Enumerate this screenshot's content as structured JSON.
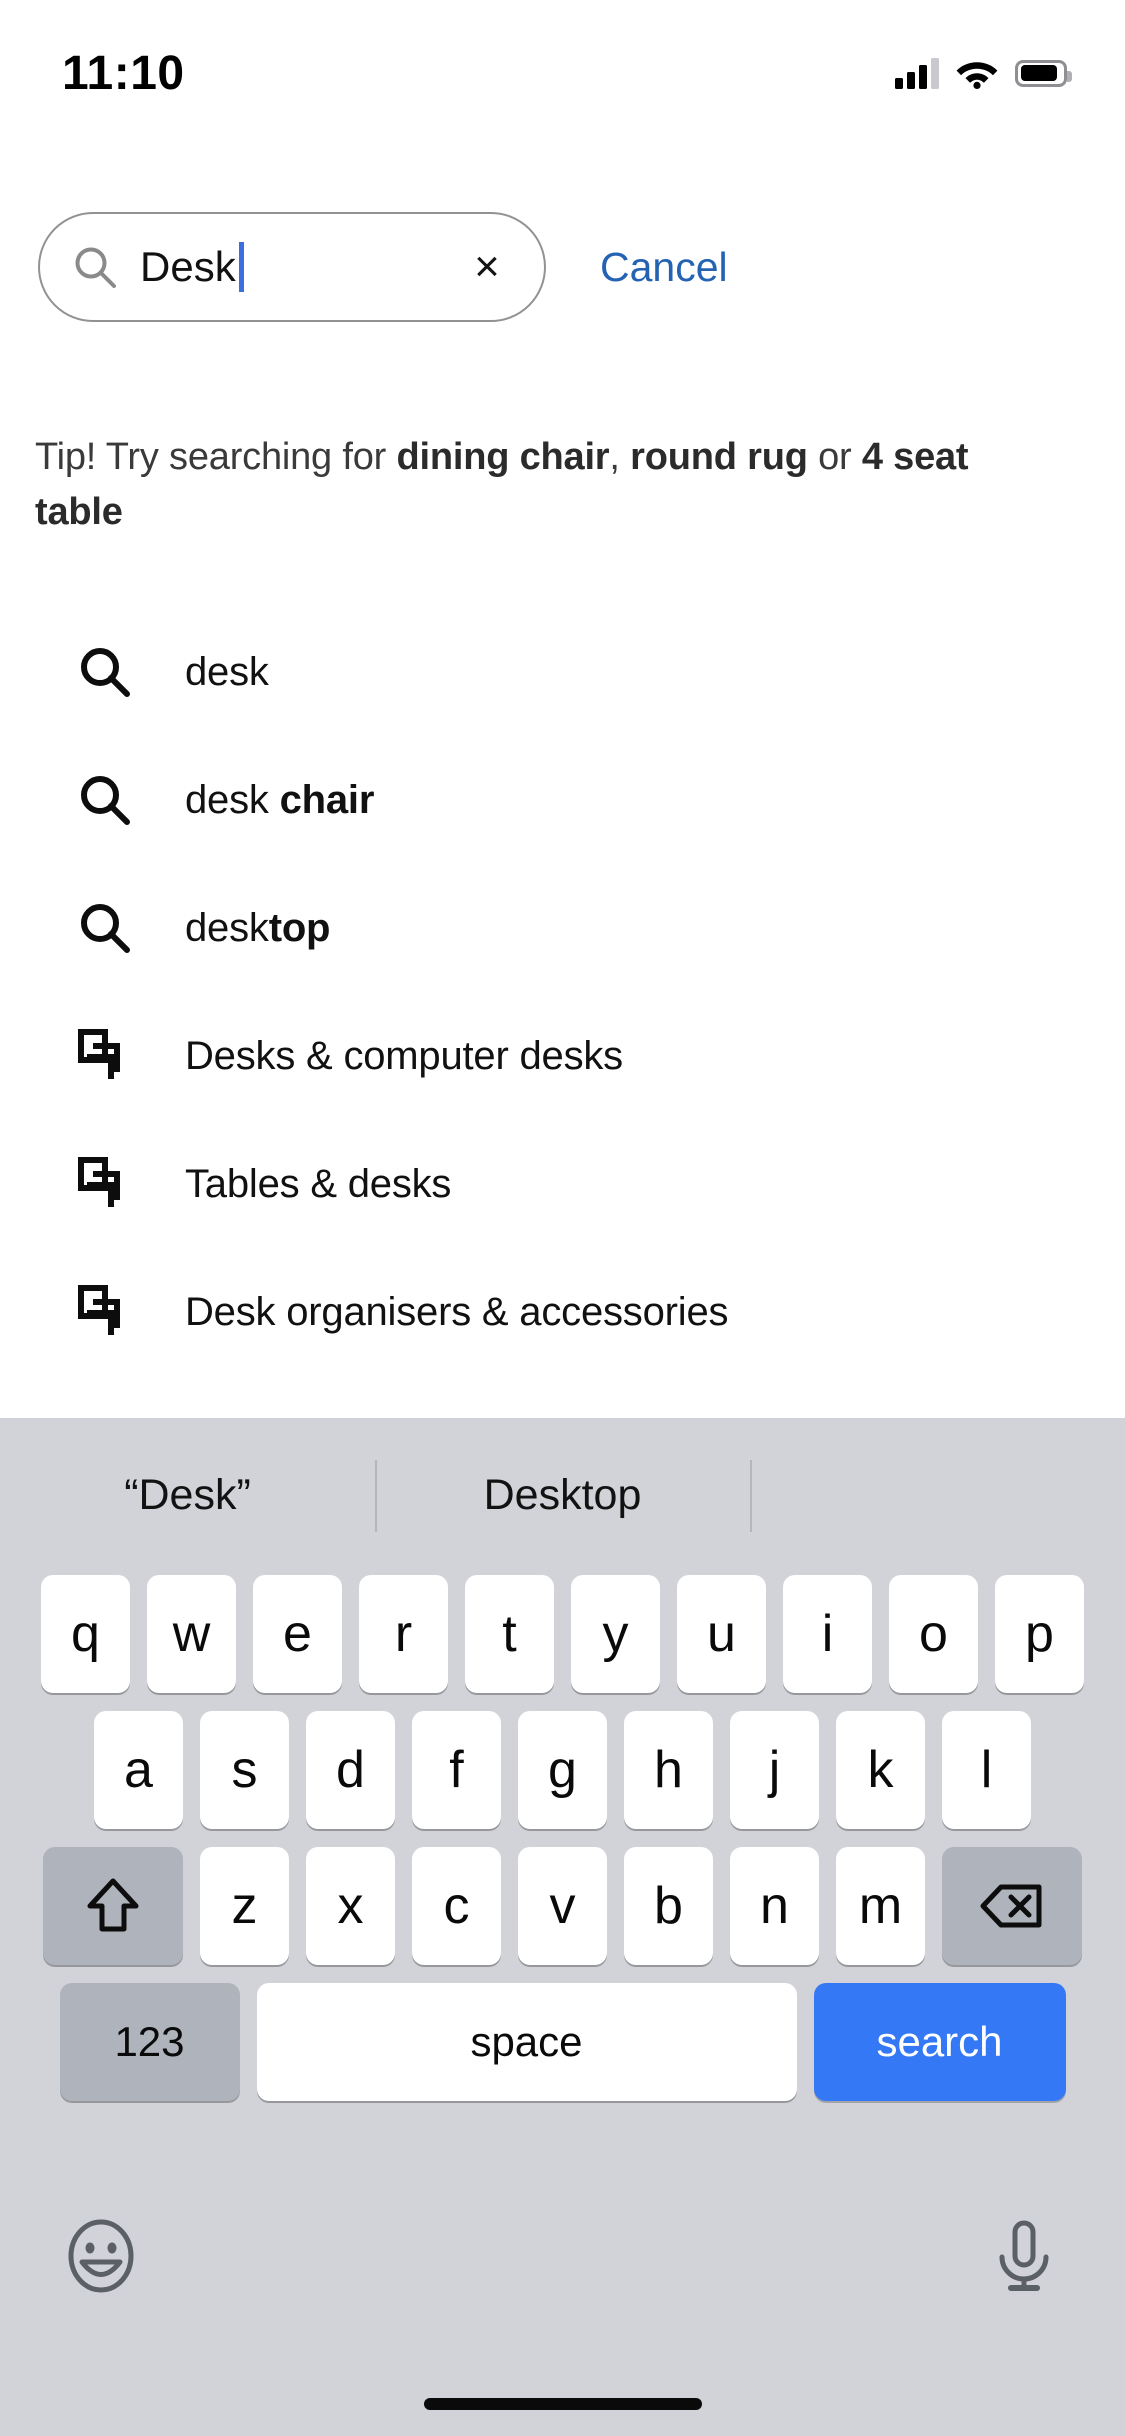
{
  "status_bar": {
    "time": "11:10",
    "signal_icon": "cellular-signal-icon",
    "wifi_icon": "wifi-icon",
    "battery_icon": "battery-icon",
    "battery_level_percent": 88
  },
  "search": {
    "icon": "search-icon",
    "value": "Desk",
    "clear_label": "×",
    "clear_icon": "close-icon",
    "cancel_label": "Cancel",
    "cancel_color": "#2462b3",
    "caret_color": "#3b6fe0"
  },
  "tip": {
    "prefix": "Tip! Try searching for ",
    "term_1": "dining chair",
    "separator_1": ", ",
    "term_2": "round rug",
    "separator_2": " or ",
    "term_3": "4 seat table"
  },
  "suggestions": [
    {
      "icon": "search-icon",
      "type": "query",
      "plain": "desk",
      "bold": ""
    },
    {
      "icon": "search-icon",
      "type": "query",
      "plain": "desk ",
      "bold": "chair"
    },
    {
      "icon": "search-icon",
      "type": "query",
      "plain": "desk",
      "bold": "top"
    },
    {
      "icon": "category-stack-icon",
      "type": "category",
      "plain": "Desks & computer desks",
      "bold": ""
    },
    {
      "icon": "category-stack-icon",
      "type": "category",
      "plain": "Tables & desks",
      "bold": ""
    },
    {
      "icon": "category-stack-icon",
      "type": "category",
      "plain": "Desk organisers & accessories",
      "bold": ""
    }
  ],
  "keyboard": {
    "predictions": [
      "“Desk”",
      "Desktop",
      ""
    ],
    "row1": [
      "q",
      "w",
      "e",
      "r",
      "t",
      "y",
      "u",
      "i",
      "o",
      "p"
    ],
    "row2": [
      "a",
      "s",
      "d",
      "f",
      "g",
      "h",
      "j",
      "k",
      "l"
    ],
    "row3": [
      "z",
      "x",
      "c",
      "v",
      "b",
      "n",
      "m"
    ],
    "shift_icon": "shift-arrow-icon",
    "backspace_icon": "backspace-icon",
    "numeric_label": "123",
    "space_label": "space",
    "return_label": "search",
    "return_color": "#3478f6",
    "emoji_icon": "emoji-smiley-icon",
    "mic_icon": "microphone-icon"
  }
}
